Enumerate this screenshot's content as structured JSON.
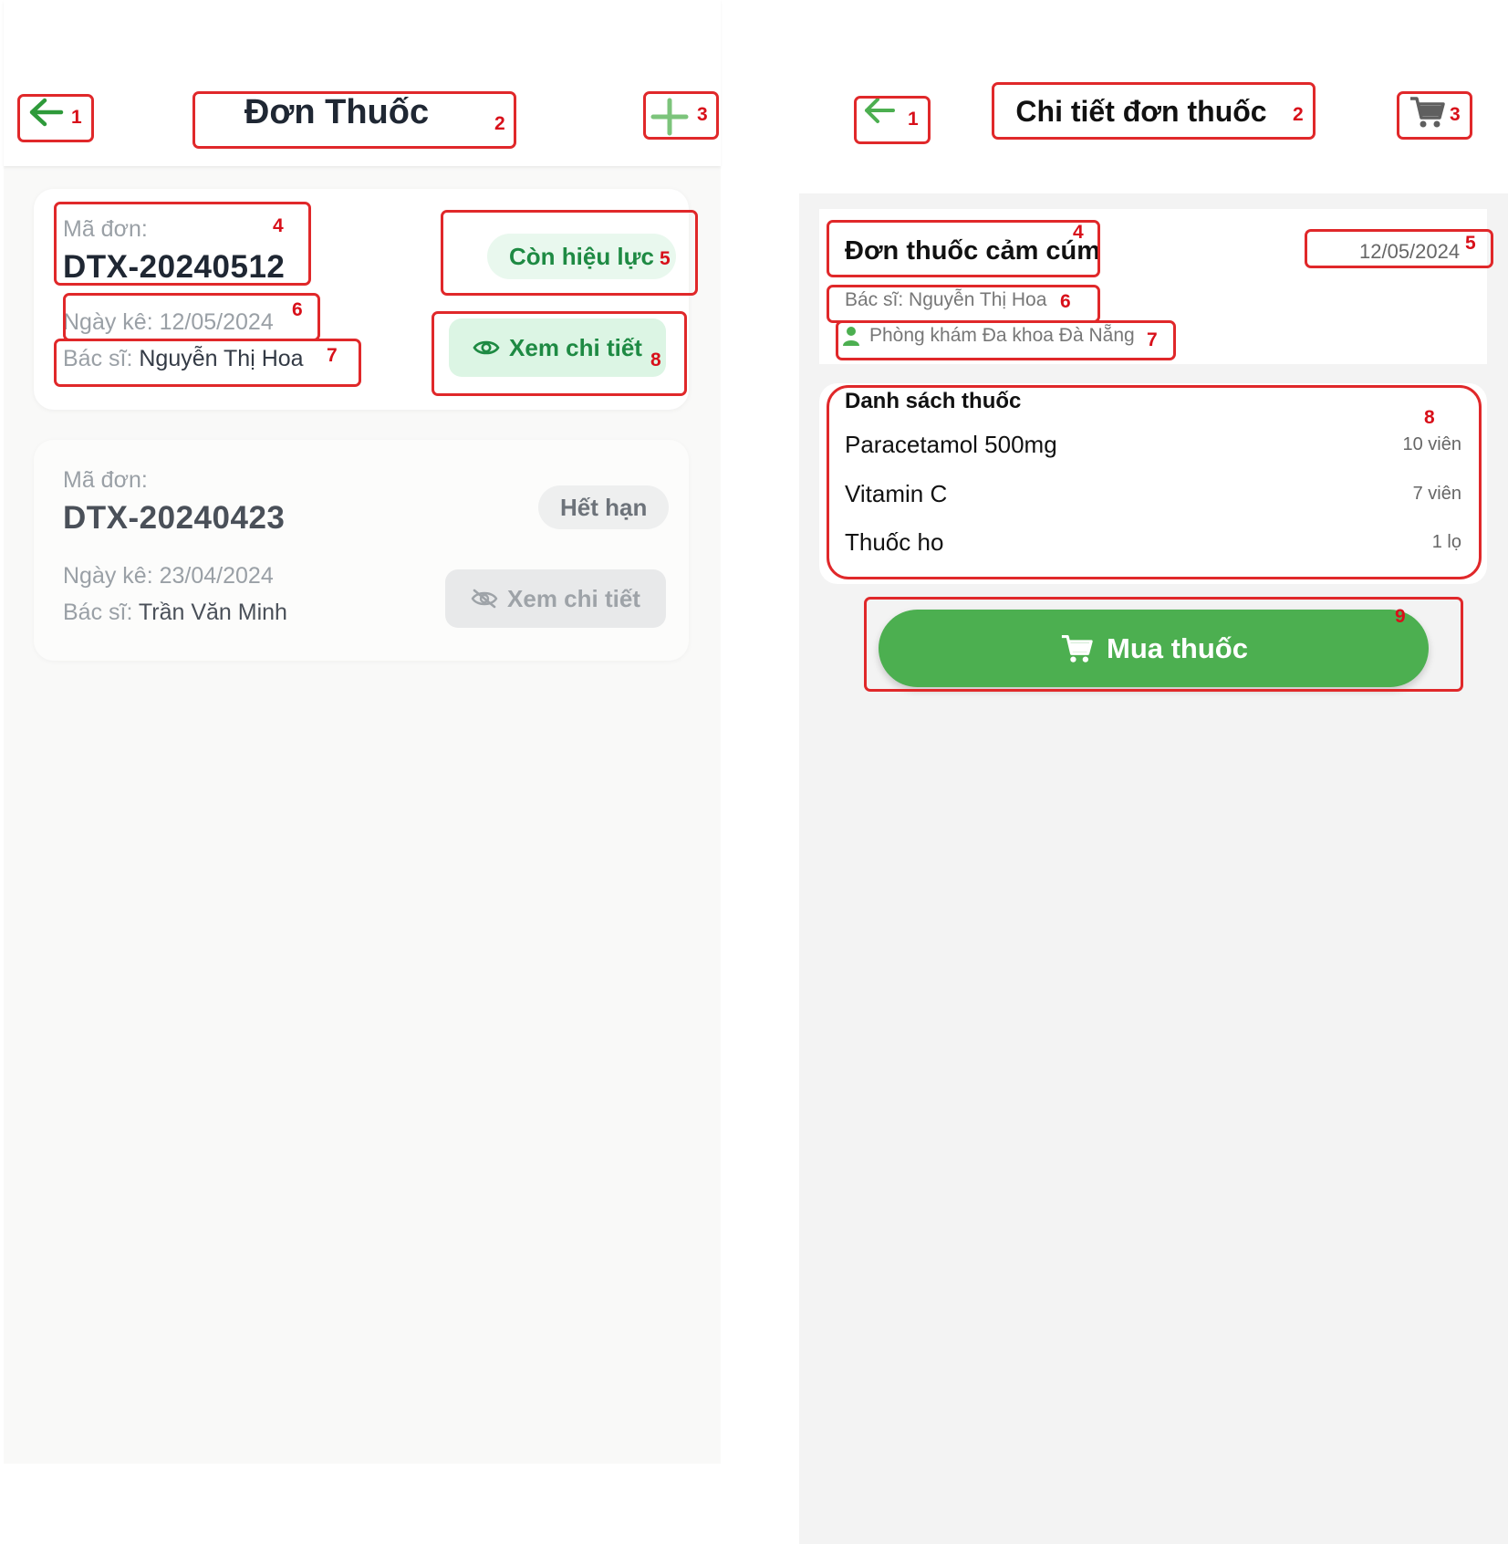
{
  "left_screen": {
    "header": {
      "title": "Đơn Thuốc",
      "back_icon": "arrow-left-icon",
      "add_icon": "plus-icon"
    },
    "prescriptions": [
      {
        "code_label": "Mã đơn:",
        "code": "DTX-20240512",
        "status": "Còn hiệu lực",
        "date_text": "Ngày kê: 12/05/2024",
        "doctor_label": "Bác sĩ:",
        "doctor_name": "Nguyễn Thị Hoa",
        "view_label": "Xem chi tiết",
        "view_icon": "eye-icon"
      },
      {
        "code_label": "Mã đơn:",
        "code": "DTX-20240423",
        "status": "Hết hạn",
        "date_text": "Ngày kê: 23/04/2024",
        "doctor_label": "Bác sĩ:",
        "doctor_name": "Trần Văn Minh",
        "view_label": "Xem chi tiết",
        "view_icon": "eye-off-icon"
      }
    ]
  },
  "right_screen": {
    "header": {
      "title": "Chi tiết đơn thuốc",
      "back_icon": "arrow-left-icon",
      "cart_icon": "cart-icon"
    },
    "prescription": {
      "name": "Đơn thuốc cảm cúm",
      "date": "12/05/2024",
      "doctor": "Bác sĩ: Nguyễn Thị Hoa",
      "clinic": "Phòng khám Đa khoa Đà Nẵng",
      "clinic_icon": "doctor-icon"
    },
    "medicine_list": {
      "title": "Danh sách thuốc",
      "items": [
        {
          "name": "Paracetamol 500mg",
          "qty": "10 viên"
        },
        {
          "name": "Vitamin C",
          "qty": "7 viên"
        },
        {
          "name": "Thuốc ho",
          "qty": "1 lọ"
        }
      ]
    },
    "buy_button": {
      "label": "Mua thuốc",
      "icon": "cart-icon"
    }
  },
  "annotations": {
    "left": [
      "1",
      "2",
      "3",
      "4",
      "5",
      "6",
      "7",
      "8"
    ],
    "right": [
      "1",
      "2",
      "3",
      "4",
      "5",
      "6",
      "7",
      "8",
      "9"
    ]
  },
  "colors": {
    "accent_green": "#4caf50",
    "status_active_text": "#1e8a43",
    "status_active_bg": "#e9f8ee",
    "annotation_red": "#e0282a",
    "title_dark": "#1f2733"
  }
}
